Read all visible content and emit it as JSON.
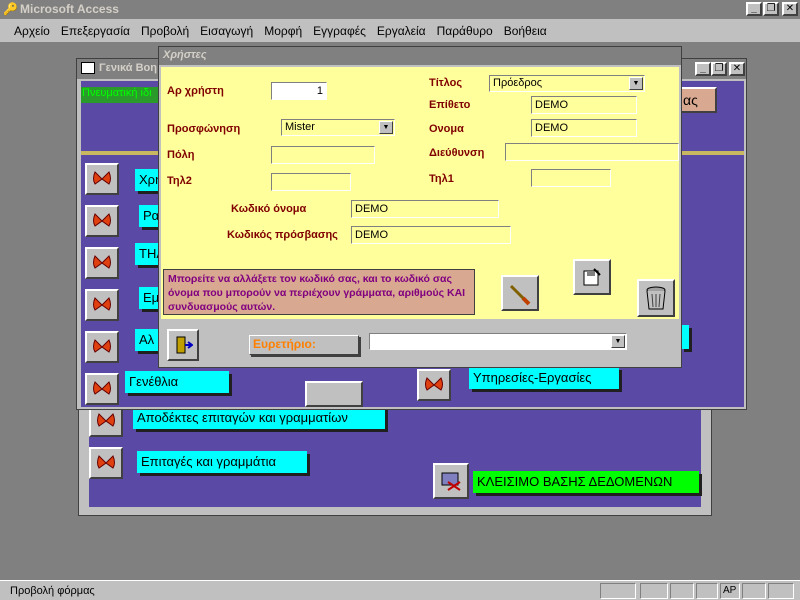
{
  "app": {
    "title": "Microsoft Access",
    "controls": {
      "minimize": "_",
      "restore": "❐",
      "close": "✕"
    }
  },
  "menu": [
    "Αρχείο",
    "Επεξεργασία",
    "Προβολή",
    "Εισαγωγή",
    "Μορφή",
    "Εγγραφές",
    "Εργαλεία",
    "Παράθυρο",
    "Βοήθεια"
  ],
  "middle_form": {
    "title": "Γενικά Βοη",
    "banner_text": "Πνευματική ιδι",
    "right_button": "ας",
    "items": [
      "Χρή",
      "Ρα",
      "ΤΗΛ",
      "Εμ",
      "Αλ",
      "Γενέθλια",
      "Υπηρεσίες-Εργασίες"
    ]
  },
  "back_form": {
    "items": [
      "Αποδέκτες επιταγών και γραμματίων",
      "Επιταγές και γραμμάτια",
      "ΚΛΕΙΣΙΜΟ ΒΑΣΗΣ ΔΕΔΟΜΕΝΩΝ"
    ]
  },
  "users": {
    "title": "Χρήστες",
    "fields": {
      "user_no_label": "Αρ χρήστη",
      "user_no": "1",
      "title_label": "Τίτλος",
      "title_value": "Πρόεδρος",
      "surname_label": "Επίθετο",
      "surname": "DEMO",
      "salutation_label": "Προσφώνηση",
      "salutation": "Mister",
      "name_label": "Ονομα",
      "name": "DEMO",
      "city_label": "Πόλη",
      "city": "",
      "address_label": "Διεύθυνση",
      "address": "",
      "phone2_label": "Τηλ2",
      "phone2": "",
      "phone1_label": "Τηλ1",
      "phone1": "",
      "codename_label": "Κωδικό όνομα",
      "codename": "DEMO",
      "password_label": "Κωδικός πρόσβασης",
      "password": "DEMO"
    },
    "note": "Μπορείτε να αλλάξετε τον κωδικό σας, και το κωδικό σας όνομα που μπορούν να περιέχουν γράμματα, αριθμούς ΚΑΙ συνδυασμούς αυτών.",
    "index_label": "Ευρετήριο:",
    "index_value": ""
  },
  "status": {
    "text": "Προβολή φόρμας",
    "mode": "AP"
  },
  "colors": {
    "form_bg": "#ffff9c",
    "menu_bg": "#5a4aa5",
    "label": "#800000",
    "cyan": "#00ffff",
    "green": "#00ff00"
  }
}
